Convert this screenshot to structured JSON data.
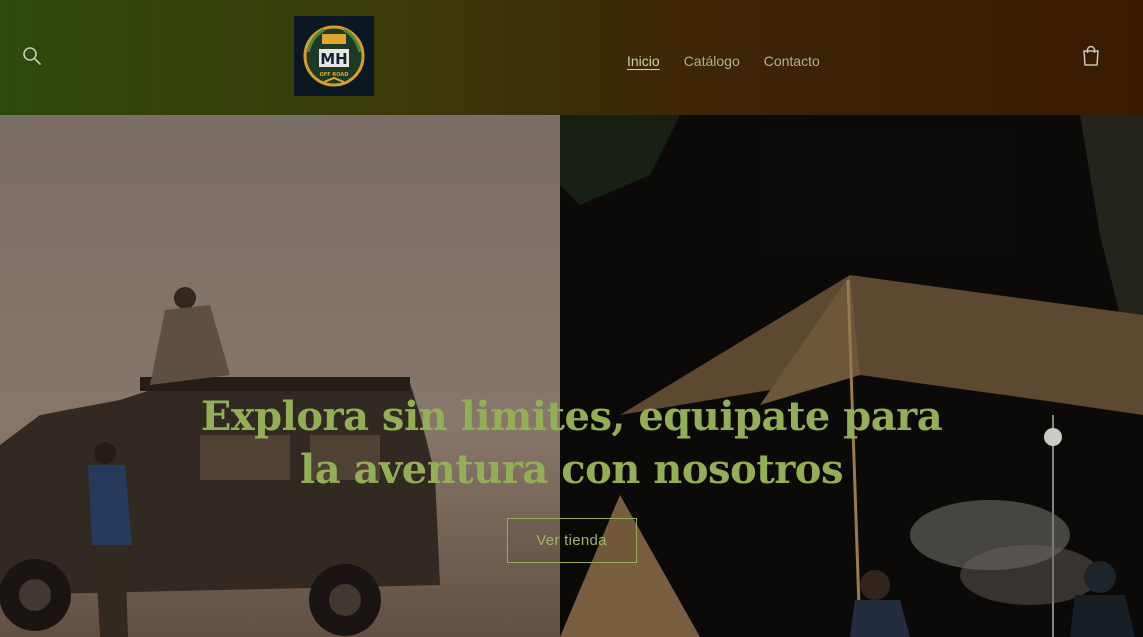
{
  "header": {
    "logo_alt": "MH Off Road",
    "logo_text": "MH",
    "logo_subtext": "OFF ROAD",
    "nav": [
      {
        "label": "Inicio",
        "active": true
      },
      {
        "label": "Catálogo",
        "active": false
      },
      {
        "label": "Contacto",
        "active": false
      }
    ],
    "icons": {
      "search": "search-icon",
      "cart": "cart-icon"
    }
  },
  "hero": {
    "title": "Explora sin limites, equipate para la aventura con nosotros",
    "button_label": "Ver tienda",
    "images": [
      "off-road-vehicle-desert",
      "night-camping-tarp"
    ]
  },
  "colors": {
    "accent": "#93ae56",
    "header_start": "#2f4a0c",
    "header_end": "#391b03"
  }
}
